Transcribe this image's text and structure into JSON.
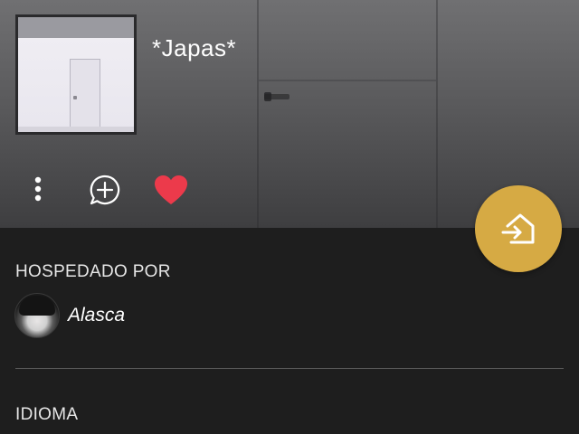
{
  "room": {
    "title": "*Japas*"
  },
  "actions": {
    "more_icon": "more-vertical-icon",
    "comment_icon": "add-comment-icon",
    "like_icon": "heart-icon",
    "like_color": "#ec3a4b"
  },
  "fab": {
    "icon": "join-room-icon",
    "color": "#d6aa44"
  },
  "host_section": {
    "label": "HOSPEDADO POR",
    "host_name": "Alasca"
  },
  "language_section": {
    "label": "IDIOMA"
  }
}
